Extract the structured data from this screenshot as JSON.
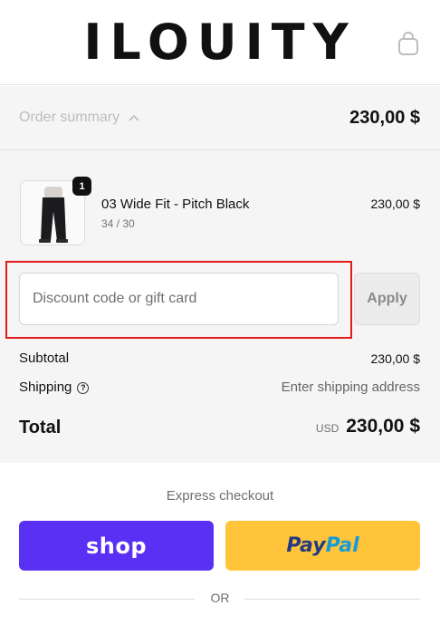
{
  "header": {
    "brand": "ILOUITY",
    "cart_icon": "shopping-bag-icon"
  },
  "summary": {
    "toggle_label": "Order summary",
    "toggle_icon": "chevron-up-icon",
    "total": "230,00 $"
  },
  "item": {
    "quantity": "1",
    "name": "03 Wide Fit - Pitch Black",
    "variant": "34 / 30",
    "price": "230,00 $"
  },
  "discount": {
    "placeholder": "Discount code or gift card",
    "value": "",
    "apply_label": "Apply"
  },
  "totals": {
    "subtotal_label": "Subtotal",
    "subtotal_value": "230,00 $",
    "shipping_label": "Shipping",
    "shipping_value": "Enter shipping address",
    "total_label": "Total",
    "currency": "USD",
    "total_value": "230,00 $"
  },
  "express": {
    "title": "Express checkout",
    "shop_label": "shop",
    "paypal_part1": "Pay",
    "paypal_part2": "Pal",
    "or_label": "OR"
  },
  "colors": {
    "shop": "#5a31f4",
    "paypal": "#ffc439",
    "highlight": "#e21a1a"
  }
}
